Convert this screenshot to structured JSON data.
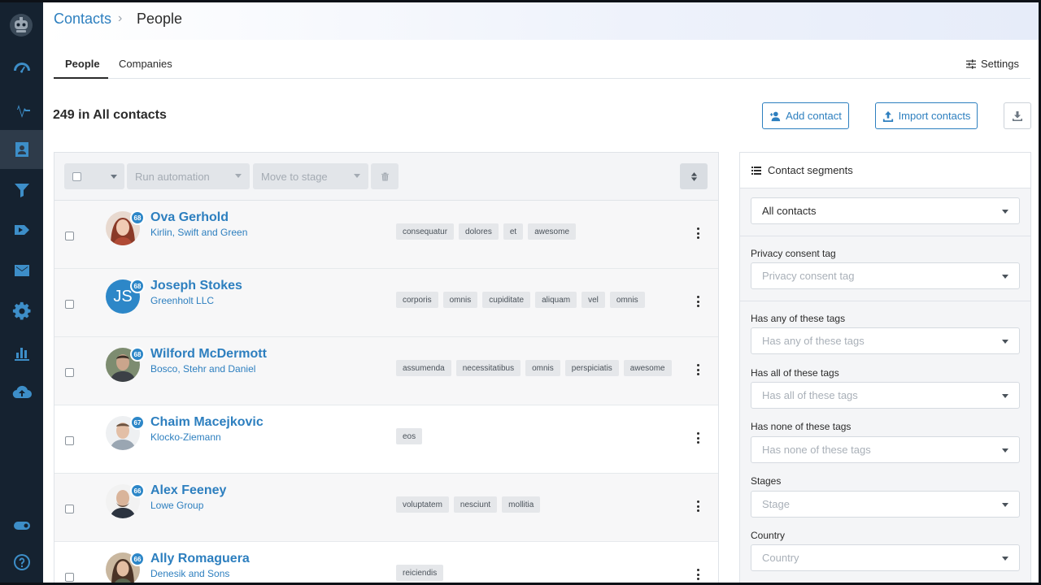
{
  "breadcrumb": {
    "root": "Contacts",
    "separator": "›",
    "current": "People"
  },
  "tabs": [
    {
      "label": "People",
      "active": true
    },
    {
      "label": "Companies",
      "active": false
    }
  ],
  "settings_label": "Settings",
  "title": "249 in All contacts",
  "actions": {
    "add_contact": "Add contact",
    "import_contacts": "Import contacts"
  },
  "toolbar": {
    "run_automation": "Run automation",
    "move_to_stage": "Move to stage"
  },
  "contacts": [
    {
      "name": "Ova Gerhold",
      "company": "Kirlin, Swift and Green",
      "score": "68",
      "initials": "",
      "tags": [
        "consequatur",
        "dolores",
        "et",
        "awesome"
      ]
    },
    {
      "name": "Joseph Stokes",
      "company": "Greenholt LLC",
      "score": "68",
      "initials": "JS",
      "tags": [
        "corporis",
        "omnis",
        "cupiditate",
        "aliquam",
        "vel",
        "omnis"
      ]
    },
    {
      "name": "Wilford McDermott",
      "company": "Bosco, Stehr and Daniel",
      "score": "68",
      "initials": "",
      "tags": [
        "assumenda",
        "necessitatibus",
        "omnis",
        "perspiciatis",
        "awesome"
      ]
    },
    {
      "name": "Chaim Macejkovic",
      "company": "Klocko-Ziemann",
      "score": "67",
      "initials": "",
      "tags": [
        "eos"
      ]
    },
    {
      "name": "Alex Feeney",
      "company": "Lowe Group",
      "score": "66",
      "initials": "",
      "tags": [
        "voluptatem",
        "nesciunt",
        "mollitia"
      ]
    },
    {
      "name": "Ally Romaguera",
      "company": "Denesik and Sons",
      "score": "66",
      "initials": "",
      "tags": [
        "reiciendis"
      ]
    }
  ],
  "segments": {
    "header": "Contact segments",
    "selected": "All contacts",
    "filters": [
      {
        "label": "Privacy consent tag",
        "placeholder": "Privacy consent tag"
      },
      {
        "label": "Has any of these tags",
        "placeholder": "Has any of these tags"
      },
      {
        "label": "Has all of these tags",
        "placeholder": "Has all of these tags"
      },
      {
        "label": "Has none of these tags",
        "placeholder": "Has none of these tags"
      },
      {
        "label": "Stages",
        "placeholder": "Stage"
      },
      {
        "label": "Country",
        "placeholder": "Country"
      }
    ]
  },
  "colors": {
    "accent": "#2d7fbf",
    "sidebar": "#152230",
    "sidebar_icon": "#3d8ec8"
  }
}
